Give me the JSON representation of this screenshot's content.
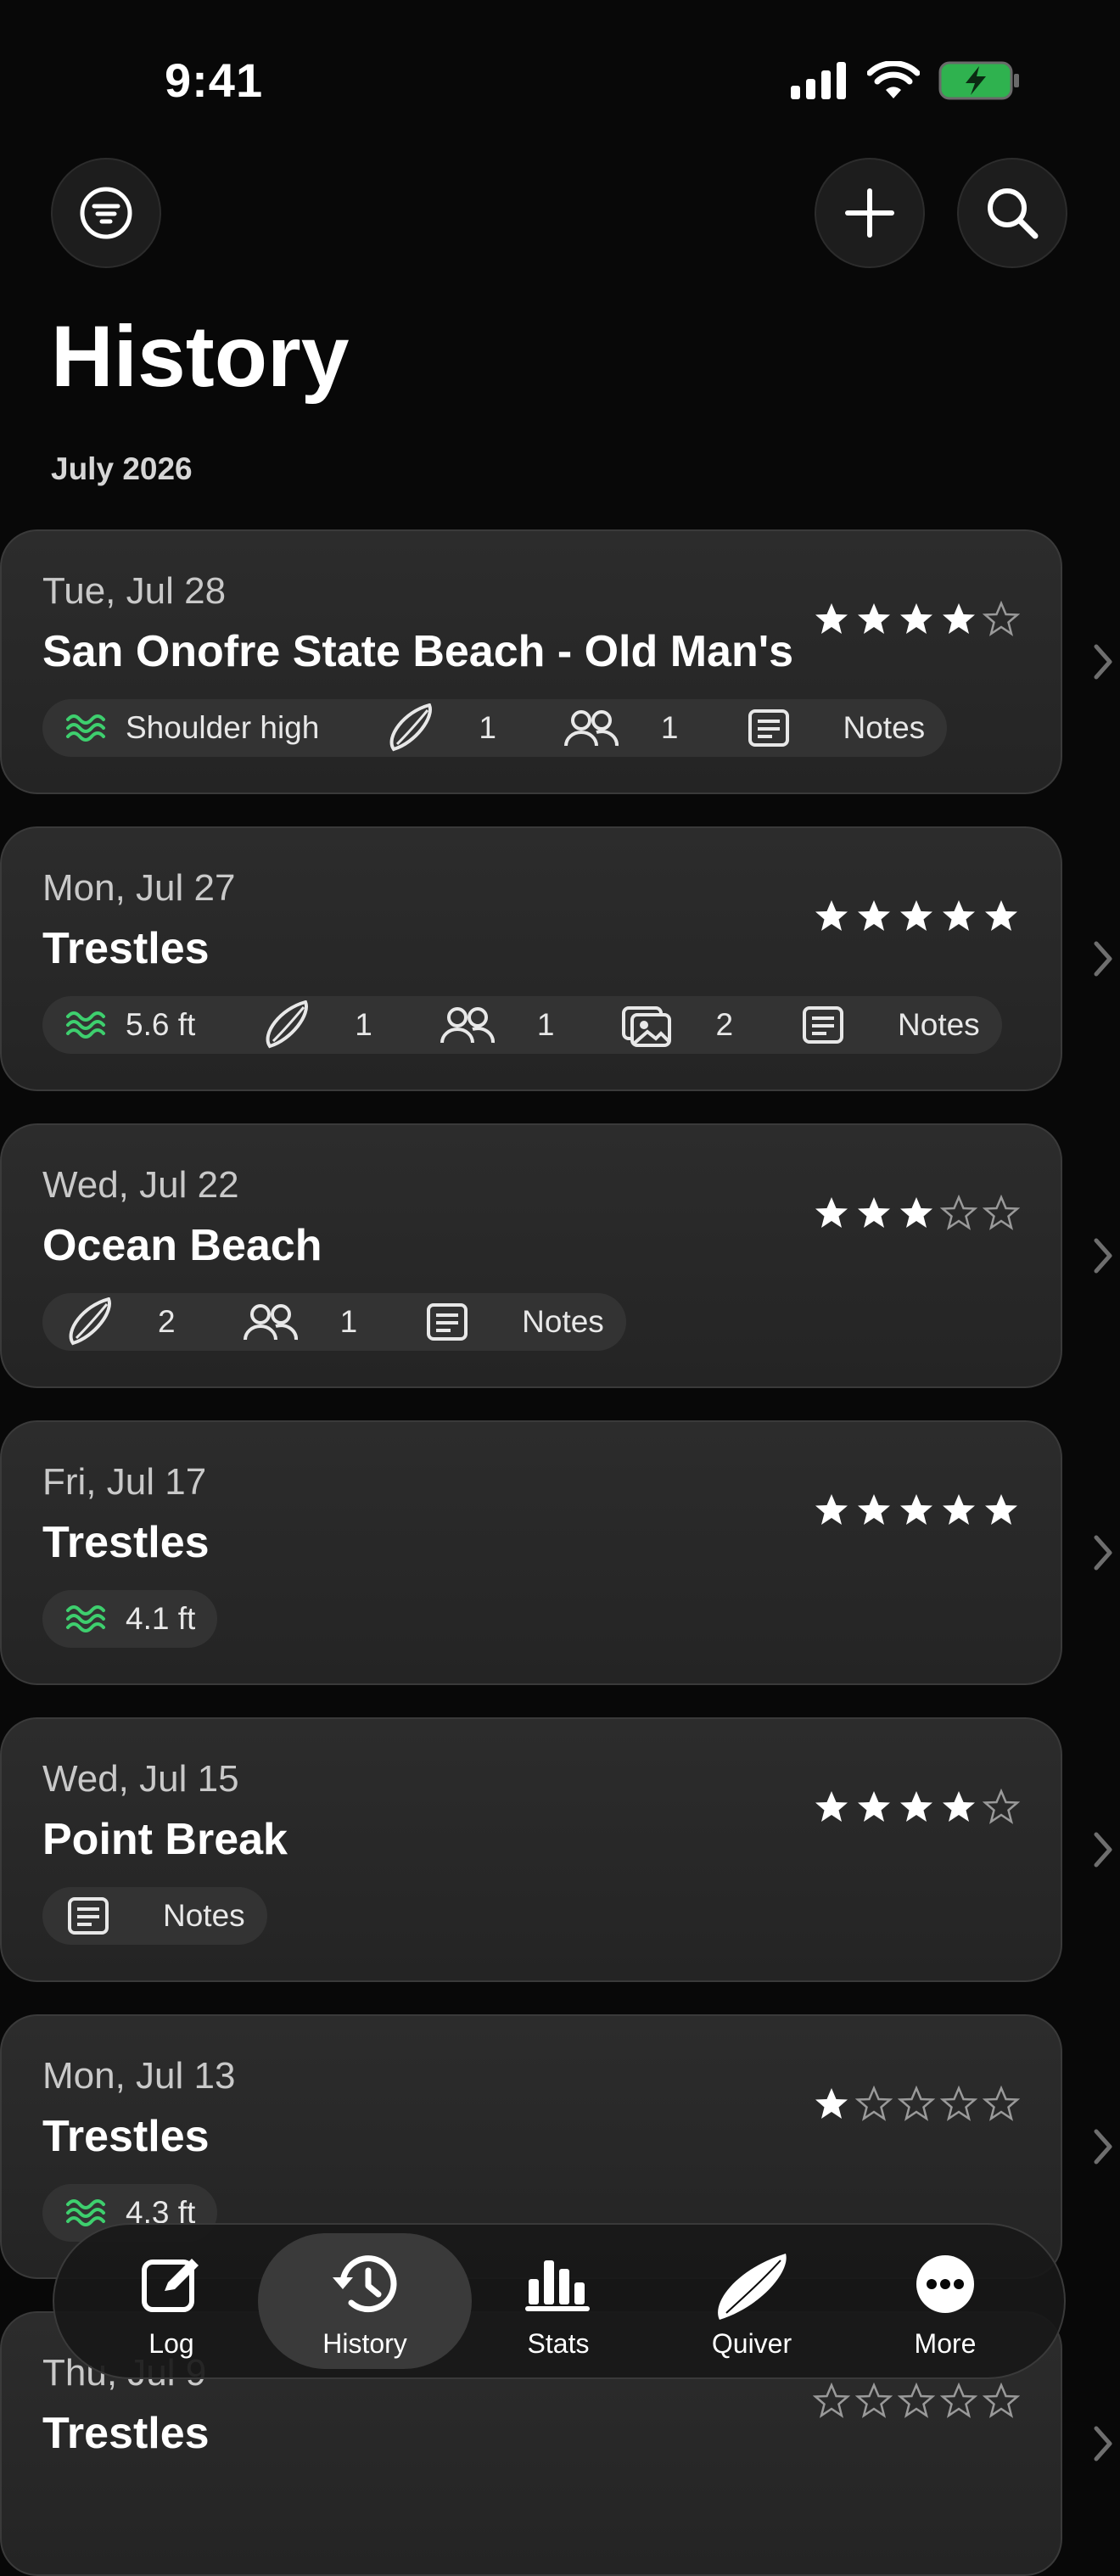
{
  "status": {
    "time": "9:41"
  },
  "header": {
    "title": "History",
    "month": "July 2026"
  },
  "sessions": [
    {
      "date": "Tue, Jul 28",
      "spot": "San Onofre State Beach - Old Man's",
      "rating": 4,
      "wave": "Shoulder high",
      "boards": "1",
      "people": "1",
      "photos": null,
      "notes": "Notes"
    },
    {
      "date": "Mon, Jul 27",
      "spot": "Trestles",
      "rating": 5,
      "wave": "5.6 ft",
      "boards": "1",
      "people": "1",
      "photos": "2",
      "notes": "Notes"
    },
    {
      "date": "Wed, Jul 22",
      "spot": "Ocean Beach",
      "rating": 3,
      "wave": null,
      "boards": "2",
      "people": "1",
      "photos": null,
      "notes": "Notes"
    },
    {
      "date": "Fri, Jul 17",
      "spot": "Trestles",
      "rating": 5,
      "wave": "4.1 ft",
      "boards": null,
      "people": null,
      "photos": null,
      "notes": null
    },
    {
      "date": "Wed, Jul 15",
      "spot": "Point Break",
      "rating": 4,
      "wave": null,
      "boards": null,
      "people": null,
      "photos": null,
      "notes": "Notes"
    },
    {
      "date": "Mon, Jul 13",
      "spot": "Trestles",
      "rating": 1,
      "wave": "4.3 ft",
      "boards": null,
      "people": null,
      "photos": null,
      "notes": null
    },
    {
      "date": "Thu, Jul 9",
      "spot": "Trestles",
      "rating": 0,
      "wave": null,
      "boards": null,
      "people": null,
      "photos": null,
      "notes": null
    }
  ],
  "tabs": [
    {
      "label": "Log",
      "icon": "compose-icon"
    },
    {
      "label": "History",
      "icon": "history-icon"
    },
    {
      "label": "Stats",
      "icon": "bar-chart-icon"
    },
    {
      "label": "Quiver",
      "icon": "surfboard-icon"
    },
    {
      "label": "More",
      "icon": "more-icon"
    }
  ],
  "active_tab": "History",
  "colors": {
    "accent_green": "#3ecf6e",
    "background": "#080808",
    "card": "#282828"
  }
}
